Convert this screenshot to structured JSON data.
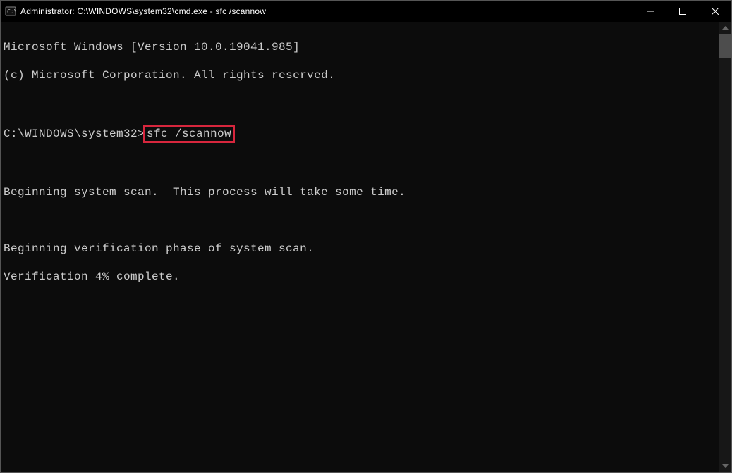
{
  "titlebar": {
    "title": "Administrator: C:\\WINDOWS\\system32\\cmd.exe - sfc  /scannow"
  },
  "terminal": {
    "line_version": "Microsoft Windows [Version 10.0.19041.985]",
    "line_copyright": "(c) Microsoft Corporation. All rights reserved.",
    "prompt_prefix": "C:\\WINDOWS\\system32>",
    "command_highlighted": "sfc /scannow",
    "line_begin_scan": "Beginning system scan.  This process will take some time.",
    "line_begin_verif": "Beginning verification phase of system scan.",
    "line_verif_progress": "Verification 4% complete."
  }
}
